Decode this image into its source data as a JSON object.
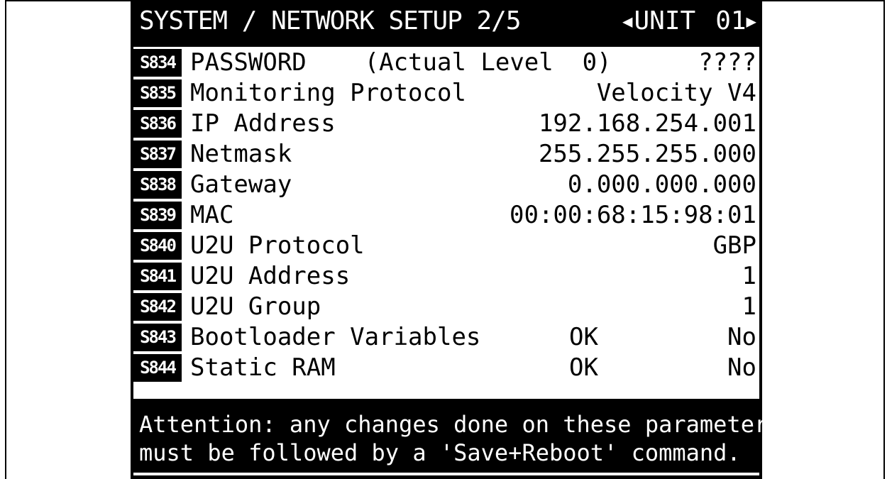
{
  "header": {
    "title": "SYSTEM / NETWORK SETUP 2/5",
    "unit_label": "UNIT",
    "unit_number": "01",
    "prev_icon": "triangle-left-icon",
    "next_icon": "triangle-right-icon"
  },
  "rows": [
    {
      "code": "S834",
      "label": "PASSWORD    (Actual Level  0)",
      "status": "",
      "value": "????"
    },
    {
      "code": "S835",
      "label": "Monitoring Protocol",
      "status": "",
      "value": "Velocity V4"
    },
    {
      "code": "S836",
      "label": "IP Address",
      "status": "",
      "value": "192.168.254.001"
    },
    {
      "code": "S837",
      "label": "Netmask",
      "status": "",
      "value": "255.255.255.000"
    },
    {
      "code": "S838",
      "label": "Gateway",
      "status": "",
      "value": "0.000.000.000"
    },
    {
      "code": "S839",
      "label": "MAC",
      "status": "",
      "value": "00:00:68:15:98:01"
    },
    {
      "code": "S840",
      "label": "U2U Protocol",
      "status": "",
      "value": "GBP"
    },
    {
      "code": "S841",
      "label": "U2U Address",
      "status": "",
      "value": "1"
    },
    {
      "code": "S842",
      "label": "U2U Group",
      "status": "",
      "value": "1"
    },
    {
      "code": "S843",
      "label": "Bootloader Variables",
      "status": "OK",
      "value": "No"
    },
    {
      "code": "S844",
      "label": "Static RAM",
      "status": "OK",
      "value": "No"
    }
  ],
  "footer": {
    "line1": "Attention: any changes done on these parameters",
    "line2": "must be followed by a 'Save+Reboot' command."
  }
}
